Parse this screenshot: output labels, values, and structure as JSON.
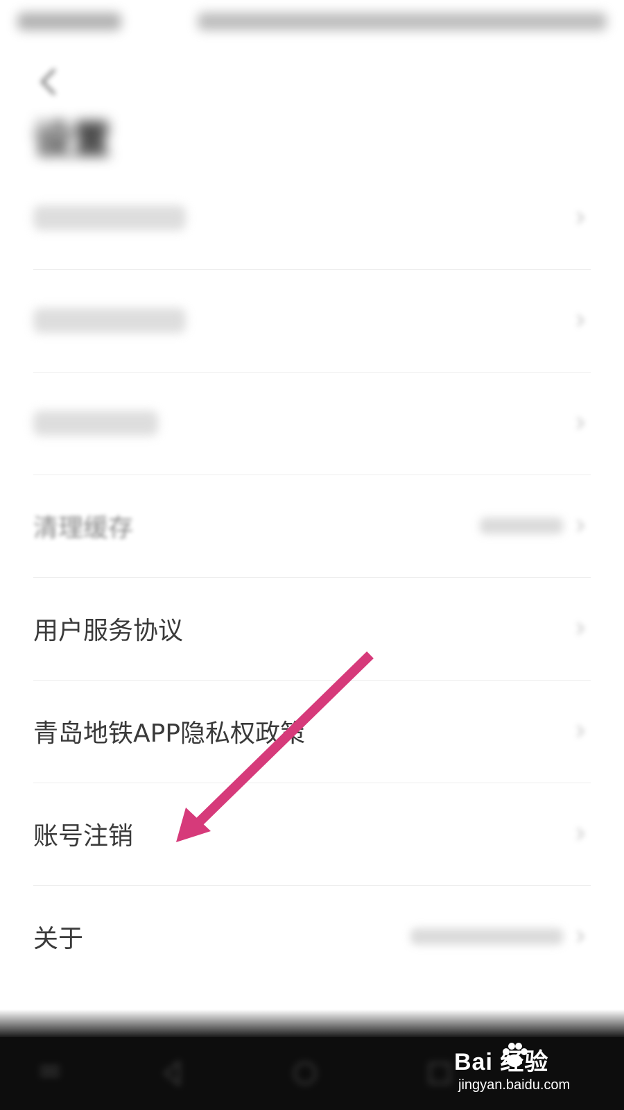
{
  "header": {
    "back_icon": "chevron-left-icon",
    "title": "设置"
  },
  "settings": {
    "items": [
      {
        "label": "",
        "visible": false,
        "value": "",
        "icon": "chevron-right-icon"
      },
      {
        "label": "",
        "visible": false,
        "value": "",
        "icon": "chevron-right-icon"
      },
      {
        "label": "",
        "visible": false,
        "value": "",
        "icon": "chevron-right-icon"
      },
      {
        "label": "清理缓存",
        "value": "",
        "icon": "chevron-right-icon"
      },
      {
        "label": "用户服务协议",
        "value": "",
        "icon": "chevron-right-icon"
      },
      {
        "label": "青岛地铁APP隐私权政策",
        "value": "",
        "icon": "chevron-right-icon"
      },
      {
        "label": "账号注销",
        "value": "",
        "icon": "chevron-right-icon"
      },
      {
        "label": "关于",
        "value": "",
        "icon": "chevron-right-icon"
      }
    ]
  },
  "annotation": {
    "arrow_color": "#d63a7a",
    "target": "账号注销"
  },
  "watermark": {
    "brand": "Bai  经验",
    "url": "jingyan.baidu.com"
  },
  "colors": {
    "background": "#ffffff",
    "text": "#3a3a3a",
    "divider": "#eeeeee",
    "nav_bar": "#0d0d0d"
  }
}
